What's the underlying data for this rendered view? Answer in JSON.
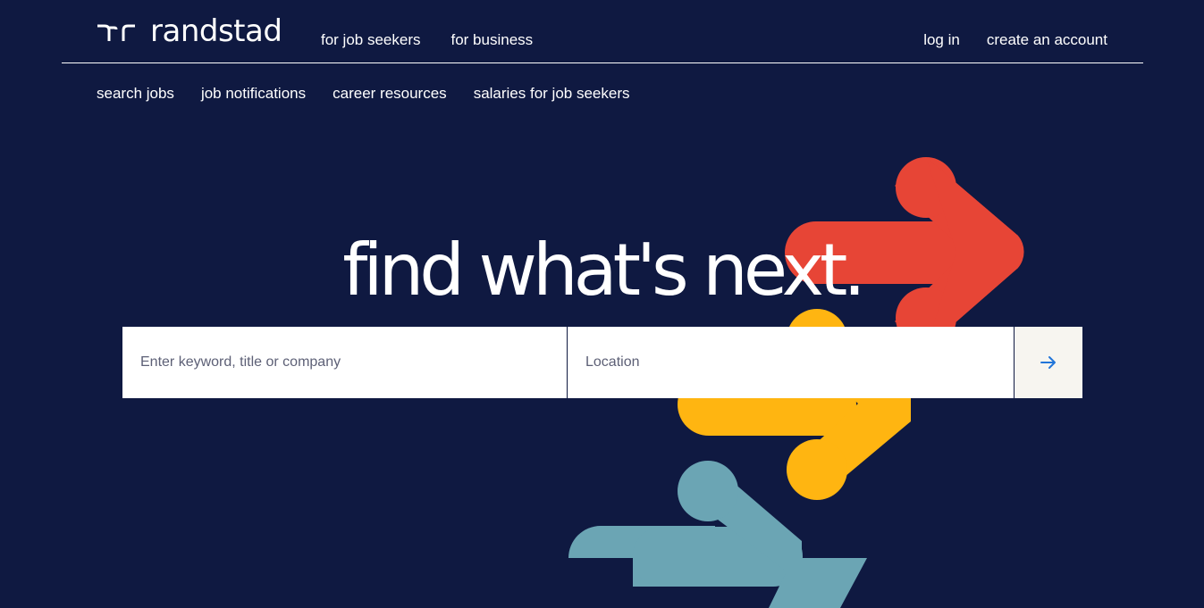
{
  "brand": {
    "name": "randstad"
  },
  "topnav": {
    "items": [
      "for job seekers",
      "for business"
    ]
  },
  "account": {
    "login": "log in",
    "create": "create an account"
  },
  "subnav": {
    "items": [
      "search jobs",
      "job notifications",
      "career resources",
      "salaries for job seekers"
    ]
  },
  "hero": {
    "headline": "find what's next."
  },
  "search": {
    "keyword_placeholder": "Enter keyword, title or company",
    "location_placeholder": "Location",
    "submit_icon": "arrow-right-icon"
  },
  "colors": {
    "background": "#0f1941",
    "arrow_red": "#e74536",
    "arrow_yellow": "#ffb511",
    "arrow_blue": "#6ba5b4",
    "search_button_bg": "#f7f5f0",
    "accent_blue": "#2175d9"
  }
}
